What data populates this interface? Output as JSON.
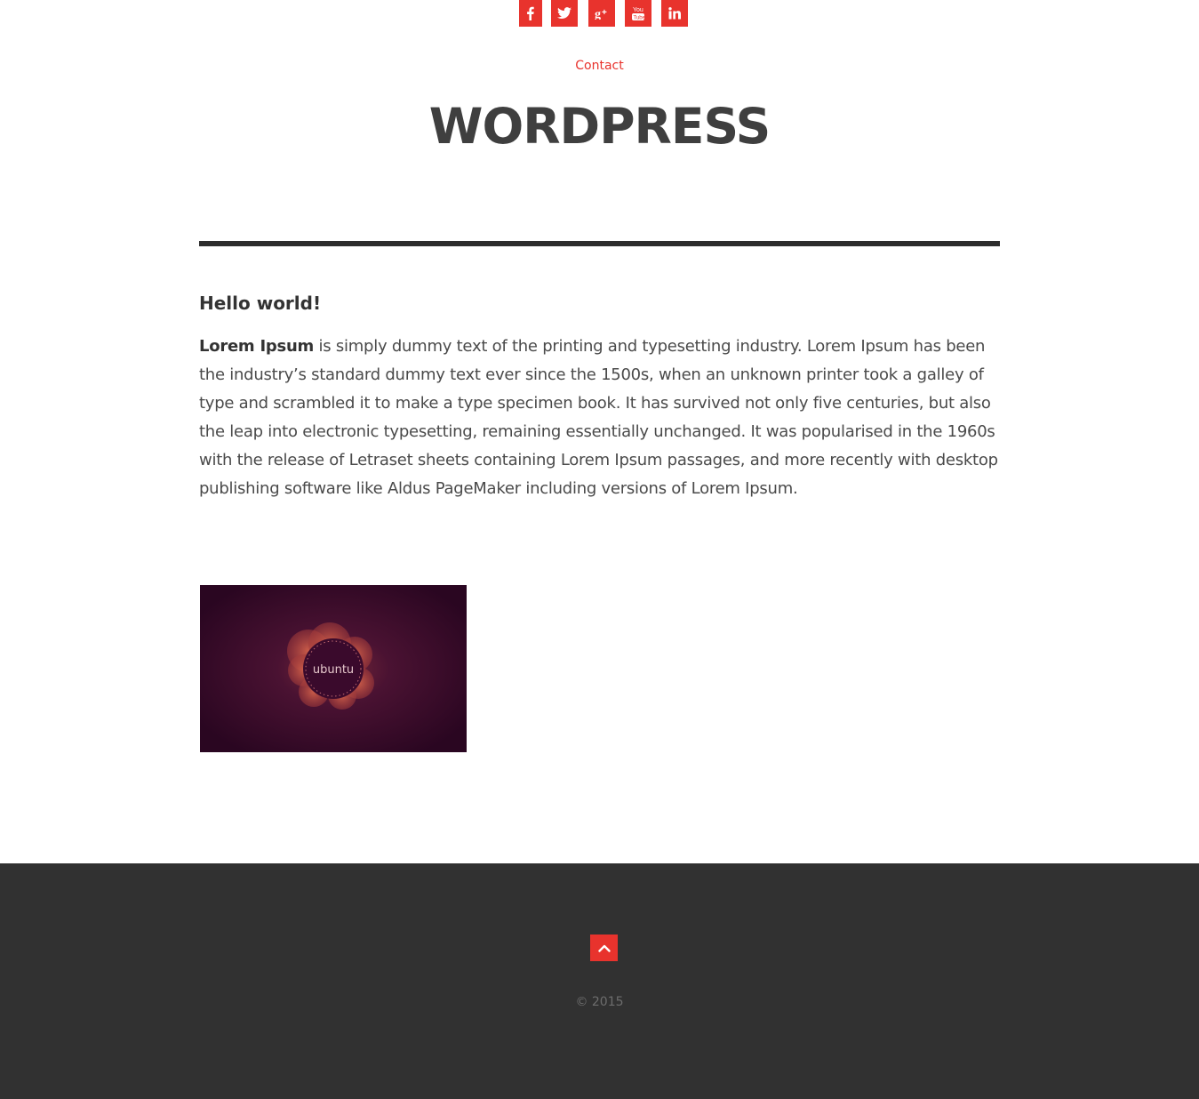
{
  "header": {
    "social": [
      {
        "icon": "facebook-icon",
        "label": "f"
      },
      {
        "icon": "twitter-icon",
        "label": "twitter"
      },
      {
        "icon": "google-plus-icon",
        "label": "g+"
      },
      {
        "icon": "youtube-icon",
        "label": "You Tube"
      },
      {
        "icon": "linkedin-icon",
        "label": "in"
      }
    ],
    "nav_contact": "Contact",
    "site_title": "WORDPRESS"
  },
  "post": {
    "title": "Hello world!",
    "lead_bold": "Lorem Ipsum",
    "body_rest": " is simply dummy text of the printing and typesetting industry. Lorem Ipsum has been the industry’s standard dummy text ever since the 1500s, when an unknown printer took a galley of type and scrambled it to make a type specimen book. It has survived not only five centuries, but also the leap into electronic typesetting, remaining essentially unchanged. It was popularised in the 1960s with the release of Letraset sheets containing Lorem Ipsum passages, and more recently with desktop publishing software like Aldus PageMaker including versions of Lorem Ipsum.",
    "image_text": "ubuntu"
  },
  "footer": {
    "to_top_icon": "chevron-up-icon",
    "copyright": "© 2015"
  },
  "colors": {
    "accent": "#e8332d",
    "title": "#3f3f3f",
    "footer_bg": "#313131",
    "image_bg": "#2a0a22"
  }
}
